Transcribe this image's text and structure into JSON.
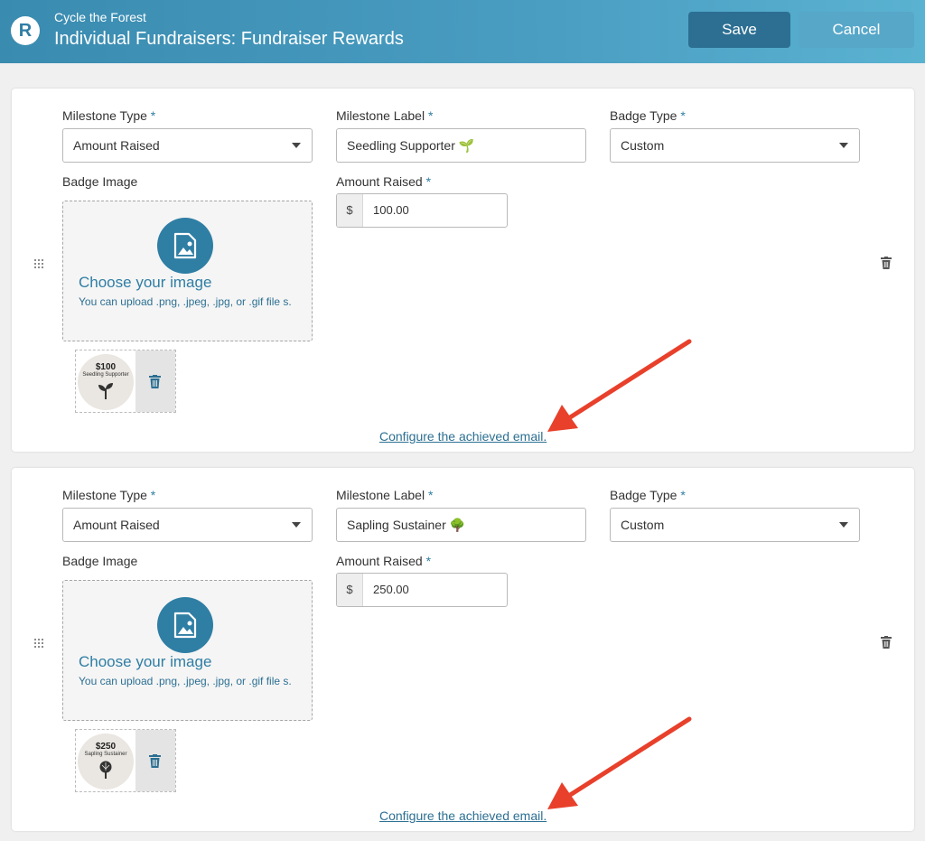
{
  "header": {
    "org": "Cycle the Forest",
    "title": "Individual Fundraisers: Fundraiser Rewards",
    "logo_letter": "R",
    "save_label": "Save",
    "cancel_label": "Cancel"
  },
  "fields": {
    "milestone_type": "Milestone Type",
    "milestone_label": "Milestone Label",
    "badge_type": "Badge Type",
    "badge_image": "Badge Image",
    "amount_raised": "Amount Raised",
    "required_mark": "*",
    "currency_prefix": "$"
  },
  "upload": {
    "choose": "Choose your image",
    "hint": "You can upload .png, .jpeg, .jpg, or .gif file s."
  },
  "link_text": "Configure the achieved email.",
  "rewards": [
    {
      "milestone_type": "Amount Raised",
      "milestone_label": "Seedling Supporter 🌱",
      "badge_type": "Custom",
      "amount": "100.00",
      "badge_amount": "$100",
      "badge_name": "Seedling Supporter"
    },
    {
      "milestone_type": "Amount Raised",
      "milestone_label": "Sapling Sustainer 🌳",
      "badge_type": "Custom",
      "amount": "250.00",
      "badge_amount": "$250",
      "badge_name": "Sapling Sustainer"
    }
  ],
  "colors": {
    "accent": "#2f7ea4",
    "arrow": "#e8402b"
  }
}
